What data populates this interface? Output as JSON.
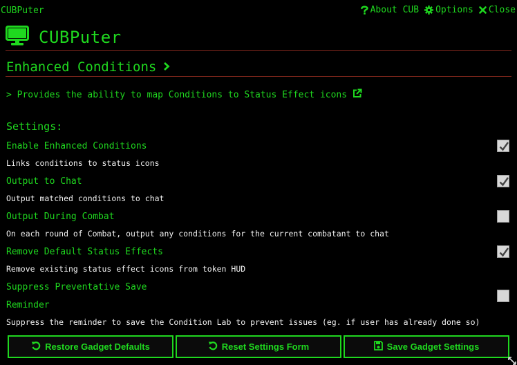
{
  "window": {
    "title": "CUBPuter"
  },
  "header_links": [
    {
      "label": "About CUB",
      "icon": "question-icon"
    },
    {
      "label": "Options",
      "icon": "gear-icon"
    },
    {
      "label": "Close",
      "icon": "close-icon"
    }
  ],
  "app": {
    "title": "CUBPuter",
    "icon": "monitor-icon"
  },
  "gadget": {
    "title": "Enhanced Conditions",
    "description": "> Provides the ability to map Conditions to Status Effect icons"
  },
  "settings": {
    "heading": "Settings:",
    "items": [
      {
        "label": "Enable Enhanced Conditions",
        "hint": "Links conditions to status icons",
        "checked": true
      },
      {
        "label": "Output to Chat",
        "hint": "Output matched conditions to chat",
        "checked": true
      },
      {
        "label": "Output During Combat",
        "hint": "On each round of Combat, output any conditions for the current combatant to chat",
        "checked": false
      },
      {
        "label": "Remove Default Status Effects",
        "hint": "Remove existing status effect icons from token HUD",
        "checked": true
      },
      {
        "label_line1": "Suppress Preventative Save",
        "label_line2": "Reminder",
        "hint": "Suppress the reminder to save the Condition Lab to prevent issues (eg. if user has already done so)",
        "checked": false
      }
    ]
  },
  "buttons": {
    "restore": "Restore Gadget Defaults",
    "reset": "Reset Settings Form",
    "save": "Save Gadget Settings"
  },
  "colors": {
    "accent": "#1fd81f",
    "divider": "#8a2a1e",
    "background": "#000000"
  }
}
